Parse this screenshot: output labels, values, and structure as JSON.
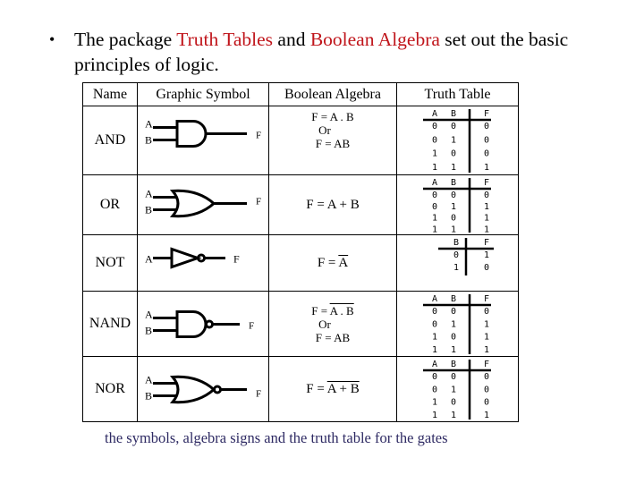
{
  "bullet": {
    "parts": [
      {
        "text": "The package ",
        "highlight": false
      },
      {
        "text": "Truth Tables",
        "highlight": true
      },
      {
        "text": " and ",
        "highlight": false
      },
      {
        "text": "Boolean Algebra",
        "highlight": true
      },
      {
        "text": " set out the basic principles of logic.",
        "highlight": false
      }
    ],
    "highlight_color": "#c0151b"
  },
  "table": {
    "headers": [
      "Name",
      "Graphic Symbol",
      "Boolean Algebra",
      "Truth Table"
    ],
    "rows": [
      {
        "name": "AND",
        "symbol": {
          "type": "and-gate",
          "inputs": [
            "A",
            "B"
          ],
          "output": "F"
        },
        "algebra": [
          {
            "text": "F = A . B",
            "overline": ""
          },
          {
            "text": "Or",
            "overline": ""
          },
          {
            "text": "F = AB",
            "overline": ""
          }
        ],
        "truth": {
          "cols": [
            "A",
            "B",
            "F"
          ],
          "rows": [
            [
              "0",
              "0",
              "0"
            ],
            [
              "0",
              "1",
              "0"
            ],
            [
              "1",
              "0",
              "0"
            ],
            [
              "1",
              "1",
              "1"
            ]
          ]
        }
      },
      {
        "name": "OR",
        "symbol": {
          "type": "or-gate",
          "inputs": [
            "A",
            "B"
          ],
          "output": "F"
        },
        "algebra": [
          {
            "text": "F = A + B",
            "overline": ""
          }
        ],
        "truth": {
          "cols": [
            "A",
            "B",
            "F"
          ],
          "rows": [
            [
              "0",
              "0",
              "0"
            ],
            [
              "0",
              "1",
              "1"
            ],
            [
              "1",
              "0",
              "1"
            ],
            [
              "1",
              "1",
              "1"
            ]
          ]
        }
      },
      {
        "name": "NOT",
        "symbol": {
          "type": "not-gate",
          "inputs": [
            "A"
          ],
          "output": "F"
        },
        "algebra": [
          {
            "text": "F = A",
            "overline": "A"
          }
        ],
        "truth": {
          "cols": [
            "B",
            "F"
          ],
          "rows": [
            [
              "0",
              "1"
            ],
            [
              "1",
              "0"
            ]
          ]
        }
      },
      {
        "name": "NAND",
        "symbol": {
          "type": "nand-gate",
          "inputs": [
            "A",
            "B"
          ],
          "output": "F"
        },
        "algebra": [
          {
            "text": "F = A . B",
            "overline": "A . B"
          },
          {
            "text": "Or",
            "overline": ""
          },
          {
            "text": "F = AB",
            "overline": ""
          }
        ],
        "truth": {
          "cols": [
            "A",
            "B",
            "F"
          ],
          "rows": [
            [
              "0",
              "0",
              "0"
            ],
            [
              "0",
              "1",
              "1"
            ],
            [
              "1",
              "0",
              "1"
            ],
            [
              "1",
              "1",
              "1"
            ]
          ]
        }
      },
      {
        "name": "NOR",
        "symbol": {
          "type": "nor-gate",
          "inputs": [
            "A",
            "B"
          ],
          "output": "F"
        },
        "algebra": [
          {
            "text": "F = A + B",
            "overline": "A + B"
          }
        ],
        "truth": {
          "cols": [
            "A",
            "B",
            "F"
          ],
          "rows": [
            [
              "0",
              "0",
              "0"
            ],
            [
              "0",
              "1",
              "0"
            ],
            [
              "1",
              "0",
              "0"
            ],
            [
              "1",
              "1",
              "1"
            ]
          ]
        }
      }
    ]
  },
  "caption": "the symbols, algebra signs and the truth table for the gates",
  "caption_color": "#2e2a63"
}
